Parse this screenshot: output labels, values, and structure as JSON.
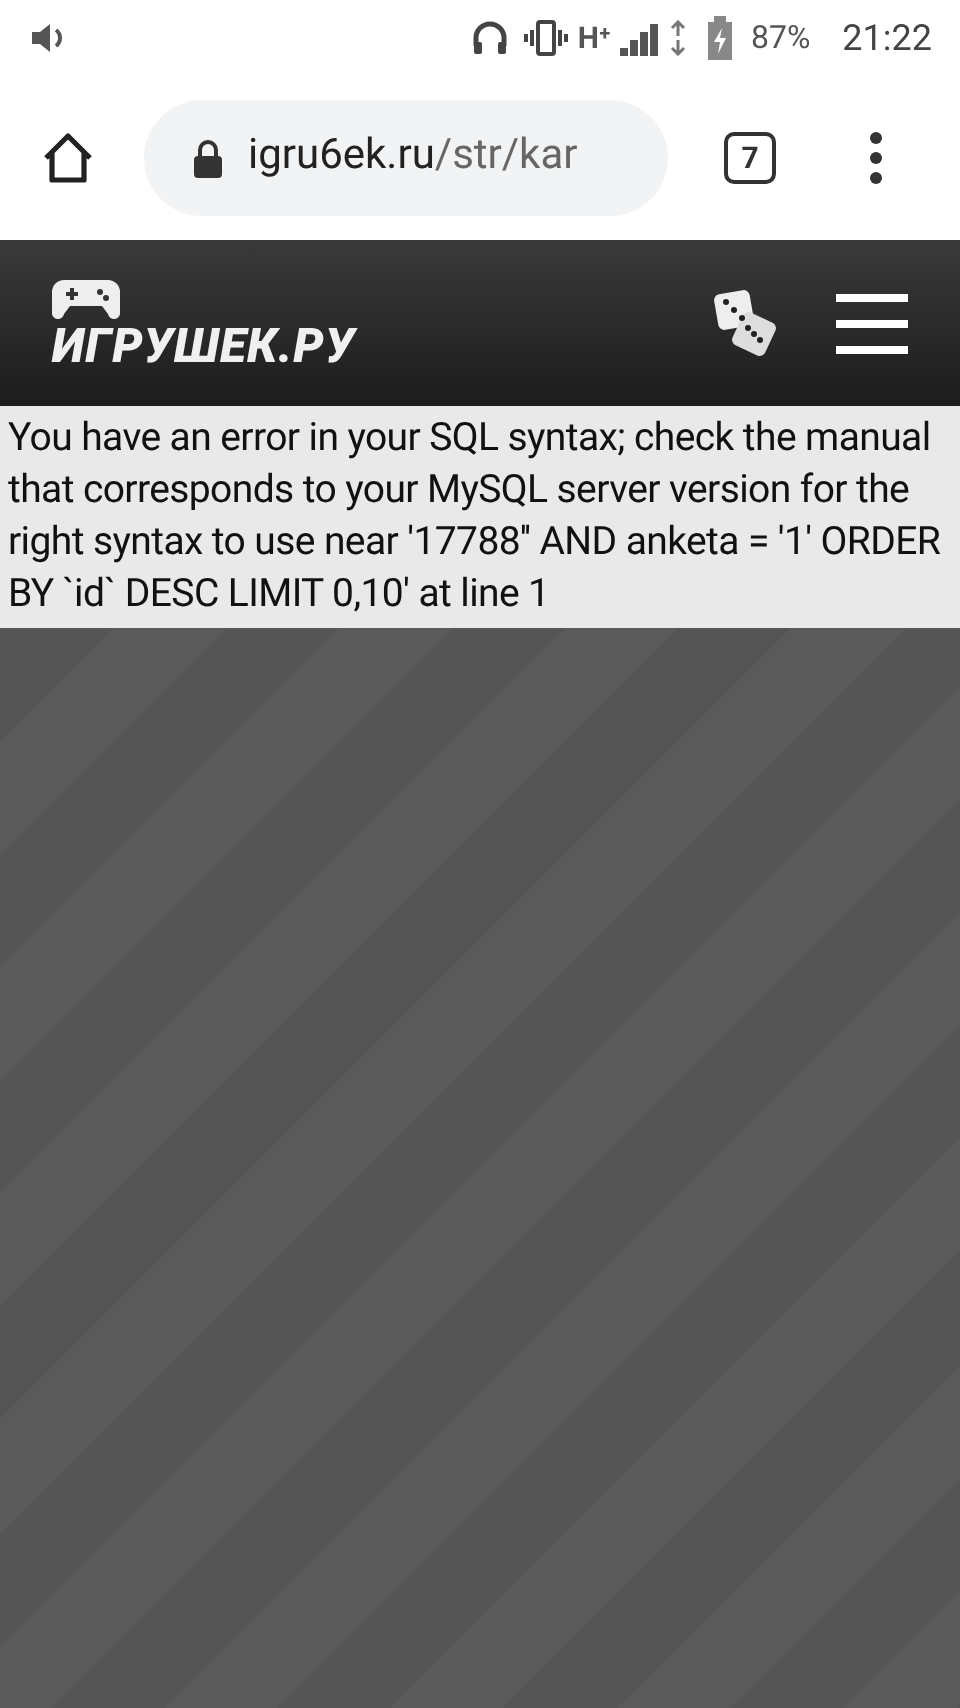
{
  "status_bar": {
    "battery": "87%",
    "time": "21:22",
    "network": "H⁺"
  },
  "browser": {
    "url_domain": "igru6ek.ru",
    "url_path": "/str/kar",
    "tab_count": "7"
  },
  "site_header": {
    "logo_text": "ИГРУШЕК.РУ"
  },
  "error_message": "You have an error in your SQL syntax; check the manual that corresponds to your MySQL server version for the right syntax to use near '17788'' AND anketa = '1' ORDER BY `id` DESC LIMIT 0,10' at line 1"
}
